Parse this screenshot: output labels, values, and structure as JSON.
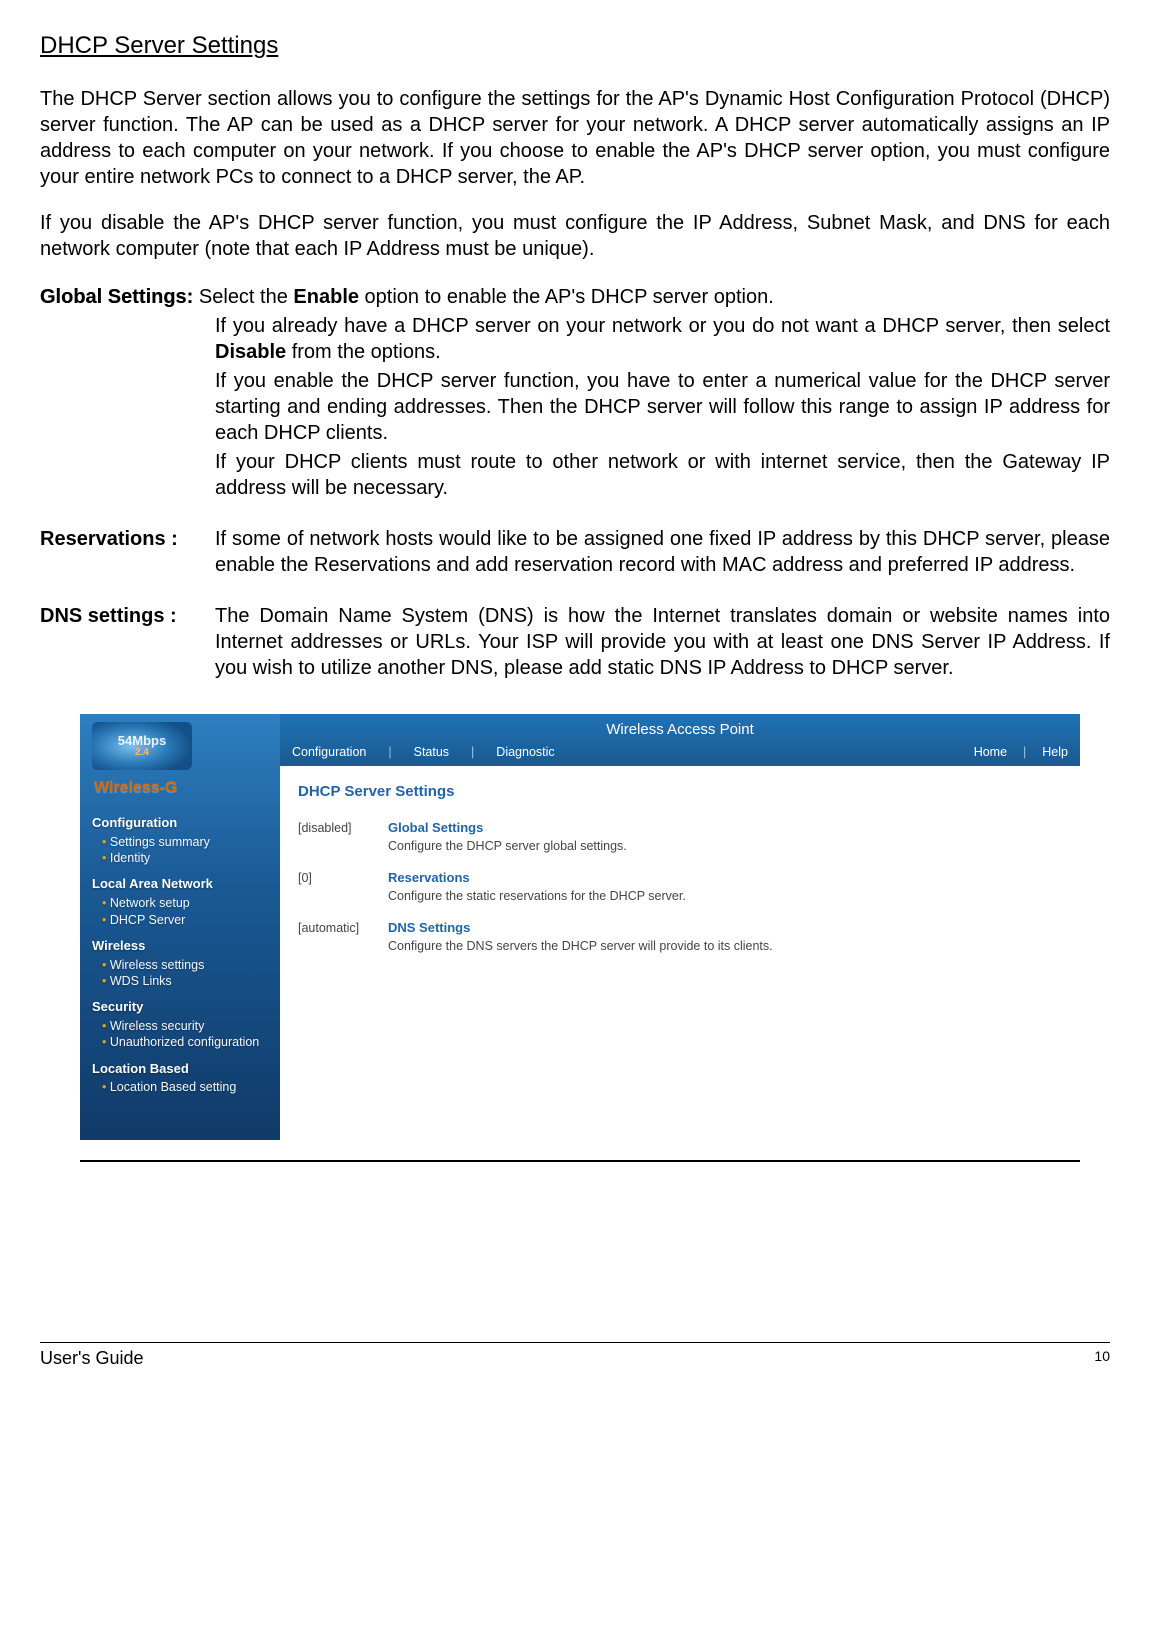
{
  "section_title": "DHCP Server  Settings",
  "intro": {
    "p1": "The DHCP Server section allows you to configure the settings for the AP's Dynamic Host Configuration Protocol (DHCP) server function. The AP can be used as a DHCP server for your network. A DHCP server automatically assigns an IP address to each computer on your network. If you choose to enable the AP's DHCP server option, you must configure your entire network PCs to connect to a DHCP server, the AP.",
    "p2": "If you disable the AP's DHCP server function, you must configure the IP Address, Subnet Mask, and DNS for each network computer (note that each IP Address must be unique)."
  },
  "global_settings": {
    "label": "Global Settings:",
    "lead": "Select the ",
    "enable": "Enable",
    "lead2": " option to enable the AP's DHCP server option.",
    "p2a": "If you already have a DHCP server on your network or you do not want a DHCP server, then select ",
    "disable": "Disable",
    "p2b": " from the options.",
    "p3": "If you enable the DHCP server function, you have to enter a numerical value for the DHCP server starting and ending addresses. Then the DHCP server will follow this range to assign IP address for each DHCP clients.",
    "p4": "If your DHCP clients must route to other network or with internet service, then the Gateway IP address will be necessary."
  },
  "reservations": {
    "label": "Reservations   :",
    "text": "If some of network hosts would like to be assigned one fixed IP address by this DHCP server, please enable the Reservations and add reservation record with MAC address and preferred IP address."
  },
  "dns_settings": {
    "label": "DNS settings   :",
    "text": "The Domain Name System (DNS) is how the Internet translates domain or website names into Internet addresses or URLs. Your ISP will provide you with at least one DNS Server IP Address. If you wish to utilize another DNS, please add static DNS IP Address to DHCP server."
  },
  "ap_ui": {
    "logo_mbps": "54Mbps",
    "logo_ghz": "2.4",
    "wireless_g": "Wireless-G",
    "title": "Wireless Access Point",
    "nav": {
      "config": "Configuration",
      "status": "Status",
      "diag": "Diagnostic",
      "home": "Home",
      "help": "Help"
    },
    "sidebar": {
      "g1": "Configuration",
      "g1_items": [
        "Settings summary",
        "Identity"
      ],
      "g2": "Local Area Network",
      "g2_items": [
        "Network setup",
        "DHCP Server"
      ],
      "g3": "Wireless",
      "g3_items": [
        "Wireless settings",
        "WDS Links"
      ],
      "g4": "Security",
      "g4_items": [
        "Wireless security",
        "Unauthorized configuration"
      ],
      "g5": "Location Based",
      "g5_items": [
        "Location Based setting"
      ]
    },
    "content": {
      "heading": "DHCP Server Settings",
      "rows": [
        {
          "status": "[disabled]",
          "link": "Global Settings",
          "desc": "Configure the DHCP server global settings."
        },
        {
          "status": "[0]",
          "link": "Reservations",
          "desc": "Configure the static reservations for the DHCP server."
        },
        {
          "status": "[automatic]",
          "link": "DNS Settings",
          "desc": "Configure the DNS servers the DHCP server will provide to its clients."
        }
      ]
    }
  },
  "footer_left": "User's Guide",
  "footer_right": "10"
}
